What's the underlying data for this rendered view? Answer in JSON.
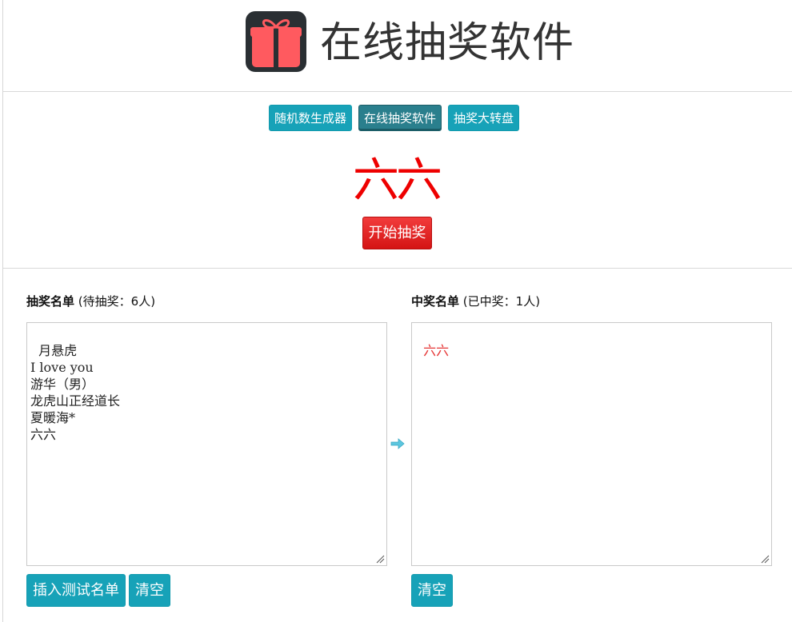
{
  "header": {
    "title": "在线抽奖软件",
    "logo_icon": "gift-icon"
  },
  "nav": {
    "items": [
      {
        "label": "随机数生成器",
        "active": false
      },
      {
        "label": "在线抽奖软件",
        "active": true
      },
      {
        "label": "抽奖大转盘",
        "active": false
      }
    ]
  },
  "draw": {
    "current_winner": "六六",
    "start_label": "开始抽奖"
  },
  "candidates": {
    "title": "抽奖名单",
    "count_text": "(待抽奖：6人)",
    "entries": "月悬虎\nI love you\n游华（男）\n龙虎山正经道长\n夏暖海*\n六六",
    "insert_label": "插入测试名单",
    "clear_label": "清空"
  },
  "winners": {
    "title": "中奖名单",
    "count_text": "(已中奖：1人)",
    "entries": "六六",
    "clear_label": "清空"
  },
  "colors": {
    "accent": "#17a2b8",
    "active_nav": "#2a7f8d",
    "winner_red": "#ee0000",
    "start_red": "#dc2323"
  }
}
